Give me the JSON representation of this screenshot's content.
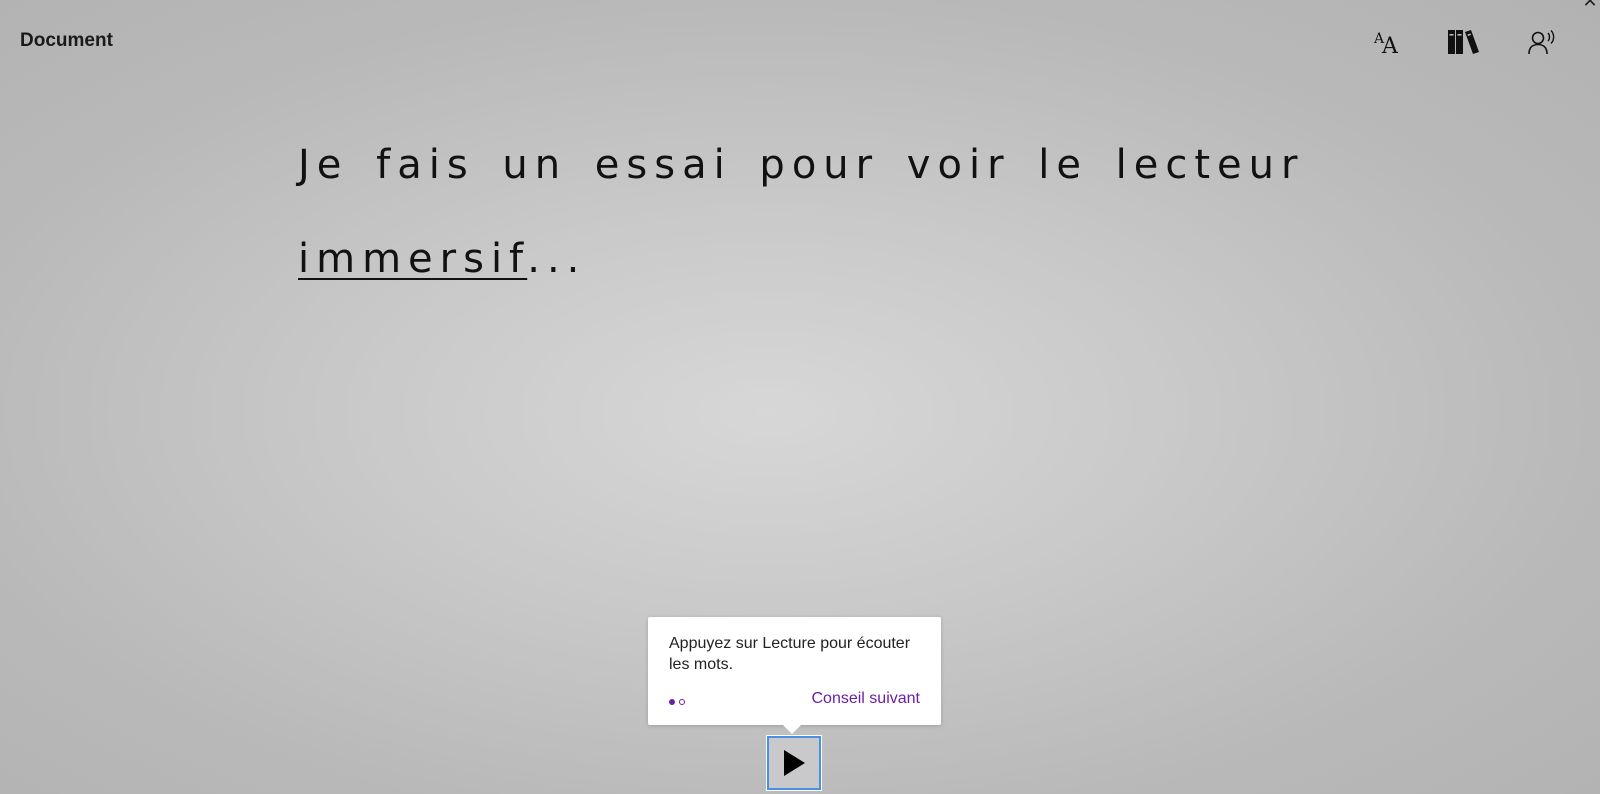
{
  "header": {
    "title": "Document"
  },
  "toolbar": {
    "text_preferences_icon": "text-size-icon",
    "grammar_options_icon": "books-icon",
    "reading_preferences_icon": "read-aloud-icon",
    "close_glyph": "✕"
  },
  "content": {
    "text_before": "Je fais un essai pour voir le lecteur ",
    "highlighted_word": "immersif",
    "text_after": "..."
  },
  "tooltip": {
    "message": "Appuyez sur Lecture pour écouter les mots.",
    "next_label": "Conseil suivant",
    "page_current": 1,
    "page_total": 2
  },
  "player": {
    "play_icon": "play-icon"
  },
  "colors": {
    "accent_purple": "#6b1fa8",
    "focus_blue": "#4a90e2"
  }
}
